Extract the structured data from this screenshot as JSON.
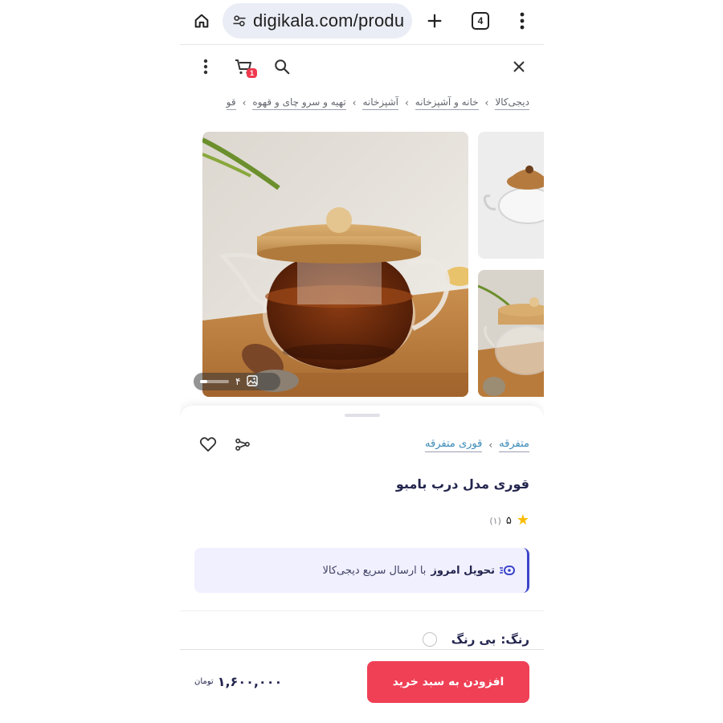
{
  "browser": {
    "url": "digikala.com/produ",
    "tab_count": "4"
  },
  "header": {
    "cart_count": "1"
  },
  "breadcrumb": {
    "items": [
      "دیجی‌کالا",
      "خانه و آشپزخانه",
      "آشپزخانه",
      "تهیه و سرو چای و قهوه",
      "قو"
    ]
  },
  "gallery": {
    "image_count": "۴",
    "current_fraction": 0.25
  },
  "product": {
    "categories": [
      "متفرقه",
      "قوری متفرقه"
    ],
    "title": "قوری مدل درب بامبو",
    "rating": "۵",
    "rating_count": "(۱)",
    "delivery_strong": "تحویل امروز",
    "delivery_rest": "با ارسال سریع دیجی‌کالا",
    "color_label": "رنگ:",
    "color_value": "بی رنگ"
  },
  "purchase": {
    "button_label": "افزودن به سبد خرید",
    "price": "۱,۶۰۰,۰۰۰",
    "currency": "تومان"
  },
  "colors": {
    "accent_red": "#ef4056",
    "delivery_bg": "#f0f0ff",
    "delivery_border": "#3b44c9",
    "star": "#f9bc00"
  }
}
